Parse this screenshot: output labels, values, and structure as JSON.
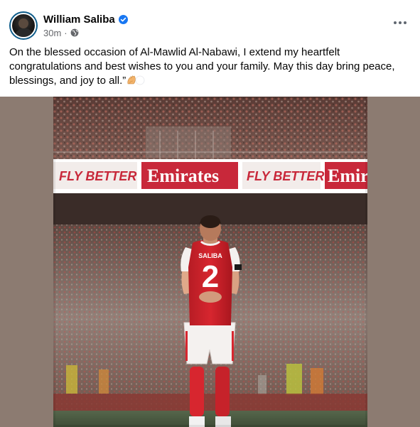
{
  "post": {
    "author_name": "William Saliba",
    "verified": true,
    "time_ago": "30m",
    "meta_separator": "·",
    "audience_icon": "globe-icon",
    "more_icon": "more-options-icon",
    "caption": "On the blessed occasion of Al-Mawlid Al-Nabawi, I extend my heartfelt congratulations and best wishes to you and your family. May this day bring peace, blessings, and joy to all.”"
  },
  "photo": {
    "board_text_1": "FLY BETTER",
    "board_text_2": "Emirates",
    "board_text_3": "FLY BETTER",
    "board_text_4": "Emir",
    "shirt_name": "SALIBA",
    "shirt_number": "2"
  },
  "colors": {
    "brand_blue": "#1877f2",
    "text_primary": "#050505",
    "text_secondary": "#65676b",
    "arsenal_red": "#d3282f",
    "photo_side_bg": "#8c7b71"
  }
}
